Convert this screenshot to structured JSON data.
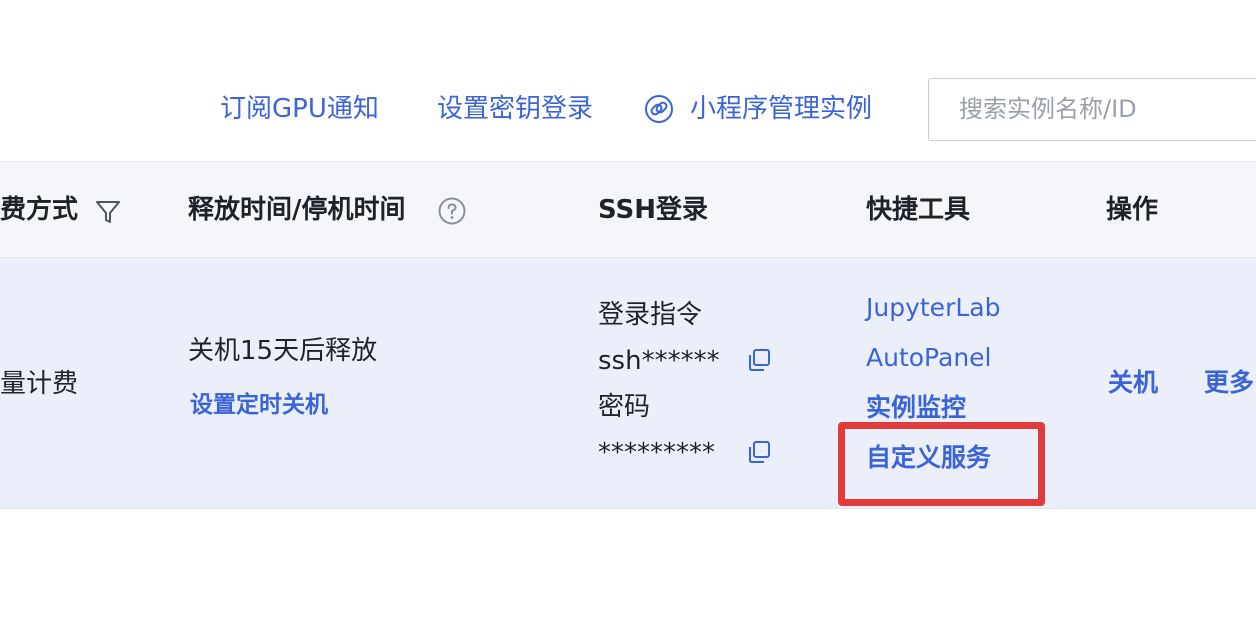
{
  "toolbar": {
    "subscribe_gpu_label": "订阅GPU通知",
    "ssh_key_label": "设置密钥登录",
    "miniprogram_label": "小程序管理实例",
    "link_icon": "link-icon",
    "search_placeholder": "搜索实例名称/ID"
  },
  "table": {
    "headers": {
      "billing": "费方式",
      "release_time": "释放时间/停机时间",
      "ssh": "SSH登录",
      "quick_tools": "快捷工具",
      "actions": "操作"
    },
    "row": {
      "billing": "量计费",
      "release_text": "关机15天后释放",
      "release_link": "设置定时关机",
      "ssh_cmd_label": "登录指令",
      "ssh_cmd_value": "ssh******",
      "password_label": "密码",
      "password_value": "*********",
      "tools": [
        "JupyterLab",
        "AutoPanel",
        "实例监控",
        "自定义服务"
      ],
      "shutdown": "关机",
      "more": "更多"
    }
  },
  "colors": {
    "accent": "#3b64d8",
    "highlight": "#e23b3b",
    "row_bg": "#ebeffa",
    "header_bg": "#f4f6fa"
  }
}
